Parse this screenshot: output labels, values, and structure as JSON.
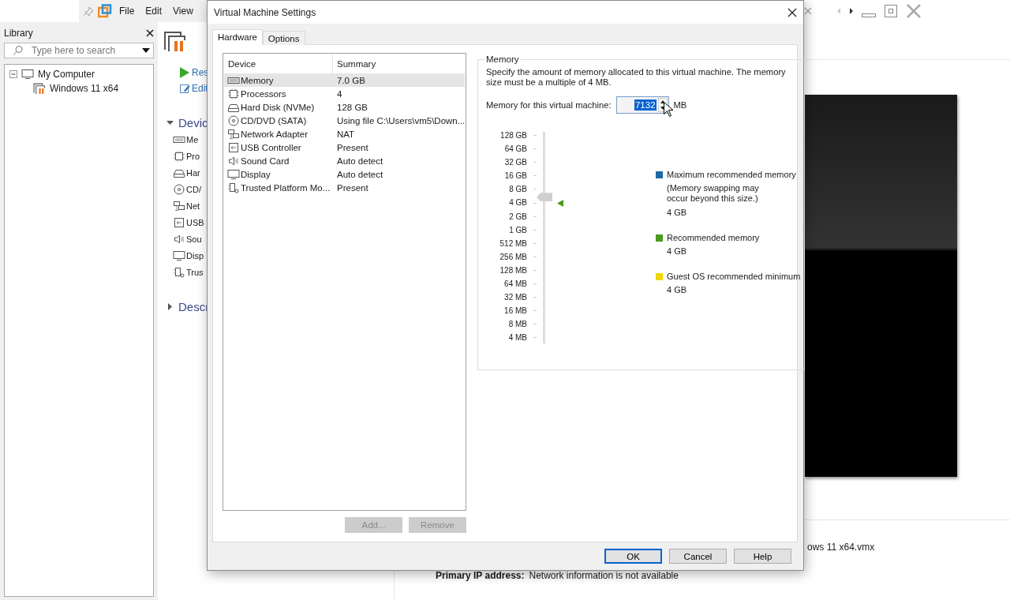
{
  "toolbar": {
    "menus": [
      "File",
      "Edit",
      "View"
    ]
  },
  "library": {
    "title": "Library",
    "search": {
      "placeholder": "Type here to search"
    },
    "tree": [
      {
        "label": "My Computer",
        "kind": "computer",
        "expanded": true,
        "children": [
          {
            "label": "Windows 11 x64",
            "kind": "vm"
          }
        ]
      }
    ]
  },
  "vm_page": {
    "actions": [
      {
        "label": "Res",
        "kind": "play"
      },
      {
        "label": "Edit",
        "kind": "edit"
      }
    ],
    "sections": [
      {
        "label": "Devic",
        "expanded": true,
        "devices": [
          {
            "label": "Me",
            "kind": "memory"
          },
          {
            "label": "Pro",
            "kind": "cpu"
          },
          {
            "label": "Har",
            "kind": "disk"
          },
          {
            "label": "CD/",
            "kind": "cd"
          },
          {
            "label": "Net",
            "kind": "network"
          },
          {
            "label": "USB",
            "kind": "usb"
          },
          {
            "label": "Sou",
            "kind": "sound"
          },
          {
            "label": "Disp",
            "kind": "display"
          },
          {
            "label": "Trus",
            "kind": "tpm"
          }
        ]
      },
      {
        "label": "Descr",
        "expanded": false
      }
    ],
    "details": [
      {
        "value": "ows 11 x64.vmx"
      },
      {
        "label": "Primary IP address:",
        "value": "Network information is not available"
      }
    ]
  },
  "dialog": {
    "title": "Virtual Machine Settings",
    "tabs": [
      {
        "label": "Hardware",
        "selected": true
      },
      {
        "label": "Options",
        "selected": false
      }
    ],
    "device_table": {
      "columns": [
        "Device",
        "Summary"
      ],
      "rows": [
        {
          "kind": "memory",
          "device": "Memory",
          "summary": "7.0 GB",
          "selected": true
        },
        {
          "kind": "cpu",
          "device": "Processors",
          "summary": "4",
          "selected": false
        },
        {
          "kind": "disk",
          "device": "Hard Disk (NVMe)",
          "summary": "128 GB",
          "selected": false
        },
        {
          "kind": "cd",
          "device": "CD/DVD (SATA)",
          "summary": "Using file C:\\Users\\vm5\\Down...",
          "selected": false
        },
        {
          "kind": "network",
          "device": "Network Adapter",
          "summary": "NAT",
          "selected": false
        },
        {
          "kind": "usb",
          "device": "USB Controller",
          "summary": "Present",
          "selected": false
        },
        {
          "kind": "sound",
          "device": "Sound Card",
          "summary": "Auto detect",
          "selected": false
        },
        {
          "kind": "display",
          "device": "Display",
          "summary": "Auto detect",
          "selected": false
        },
        {
          "kind": "tpm",
          "device": "Trusted Platform Mo...",
          "summary": "Present",
          "selected": false
        }
      ]
    },
    "list_buttons": [
      {
        "label": "Add...",
        "disabled": true
      },
      {
        "label": "Remove",
        "disabled": true
      }
    ],
    "memory": {
      "title": "Memory",
      "description": "Specify the amount of memory allocated to this virtual machine. The memory size must be a multiple of 4 MB.",
      "field_label": "Memory for this virtual machine:",
      "value": "7132",
      "unit": "MB",
      "slider": {
        "level": 0.72
      },
      "scale": [
        {
          "label": "128 GB",
          "marked": false
        },
        {
          "label": "64 GB",
          "marked": false
        },
        {
          "label": "32 GB",
          "marked": false
        },
        {
          "label": "16 GB",
          "marked": false
        },
        {
          "label": "8 GB",
          "marked": false
        },
        {
          "label": "4 GB",
          "marked": true
        },
        {
          "label": "2 GB",
          "marked": false
        },
        {
          "label": "1 GB",
          "marked": false
        },
        {
          "label": "512 MB",
          "marked": false
        },
        {
          "label": "256 MB",
          "marked": false
        },
        {
          "label": "128 MB",
          "marked": false
        },
        {
          "label": "64 MB",
          "marked": false
        },
        {
          "label": "32 MB",
          "marked": false
        },
        {
          "label": "16 MB",
          "marked": false
        },
        {
          "label": "8 MB",
          "marked": false
        },
        {
          "label": "4 MB",
          "marked": false
        }
      ],
      "legend": [
        {
          "color": "#1a6aa8",
          "title": "Maximum recommended memory",
          "note": "(Memory swapping may occur beyond this size.)",
          "value": "4 GB"
        },
        {
          "color": "#4c9a1e",
          "title": "Recommended memory",
          "value": "4 GB"
        },
        {
          "color": "#f2d600",
          "title": "Guest OS recommended minimum",
          "value": "4 GB"
        }
      ]
    },
    "buttons": [
      {
        "label": "OK",
        "default": true
      },
      {
        "label": "Cancel",
        "default": false
      },
      {
        "label": "Help",
        "default": false
      }
    ]
  }
}
